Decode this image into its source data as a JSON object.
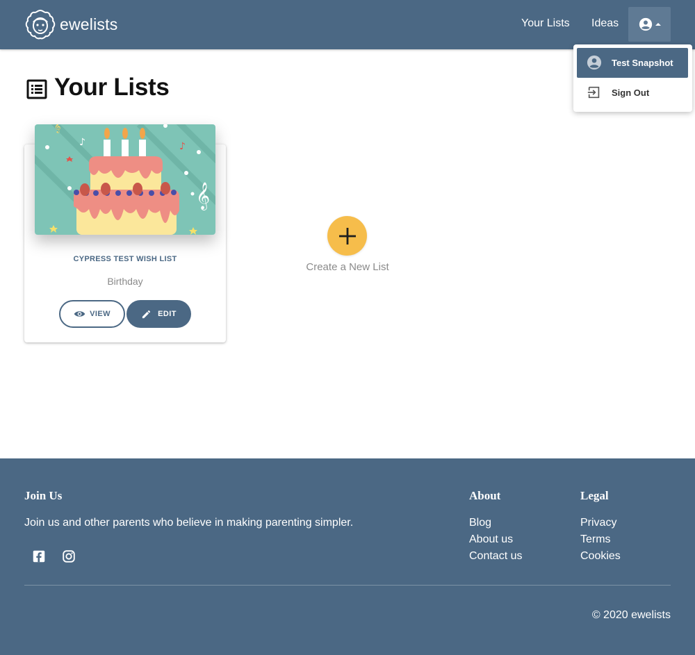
{
  "colors": {
    "primary": "#4b6884",
    "accent": "#f6bd4b",
    "white": "#ffffff"
  },
  "header": {
    "brand": "ewelists",
    "logo_icon": "sheep-logo-icon",
    "nav": [
      {
        "label": "Your Lists"
      },
      {
        "label": "Ideas"
      }
    ],
    "account_icon": "account-circle-icon"
  },
  "account_menu": {
    "items": [
      {
        "label": "Test Snapshot",
        "icon": "account-circle-icon"
      },
      {
        "label": "Sign Out",
        "icon": "exit-icon"
      }
    ]
  },
  "page": {
    "title": "Your Lists",
    "title_icon": "list-icon"
  },
  "lists": [
    {
      "title": "CYPRESS TEST WISH LIST",
      "occasion": "Birthday",
      "image": "birthday-cake-illustration",
      "view_label": "VIEW",
      "edit_label": "EDIT"
    }
  ],
  "create": {
    "label": "Create a New List",
    "icon": "plus-icon"
  },
  "footer": {
    "join_heading": "Join Us",
    "join_text": "Join us and other parents who believe in making parenting simpler.",
    "social_icons": [
      "facebook-icon",
      "instagram-icon"
    ],
    "about_heading": "About",
    "about_links": [
      "Blog",
      "About us",
      "Contact us"
    ],
    "legal_heading": "Legal",
    "legal_links": [
      "Privacy",
      "Terms",
      "Cookies"
    ],
    "copyright": "© 2020 ewelists"
  }
}
